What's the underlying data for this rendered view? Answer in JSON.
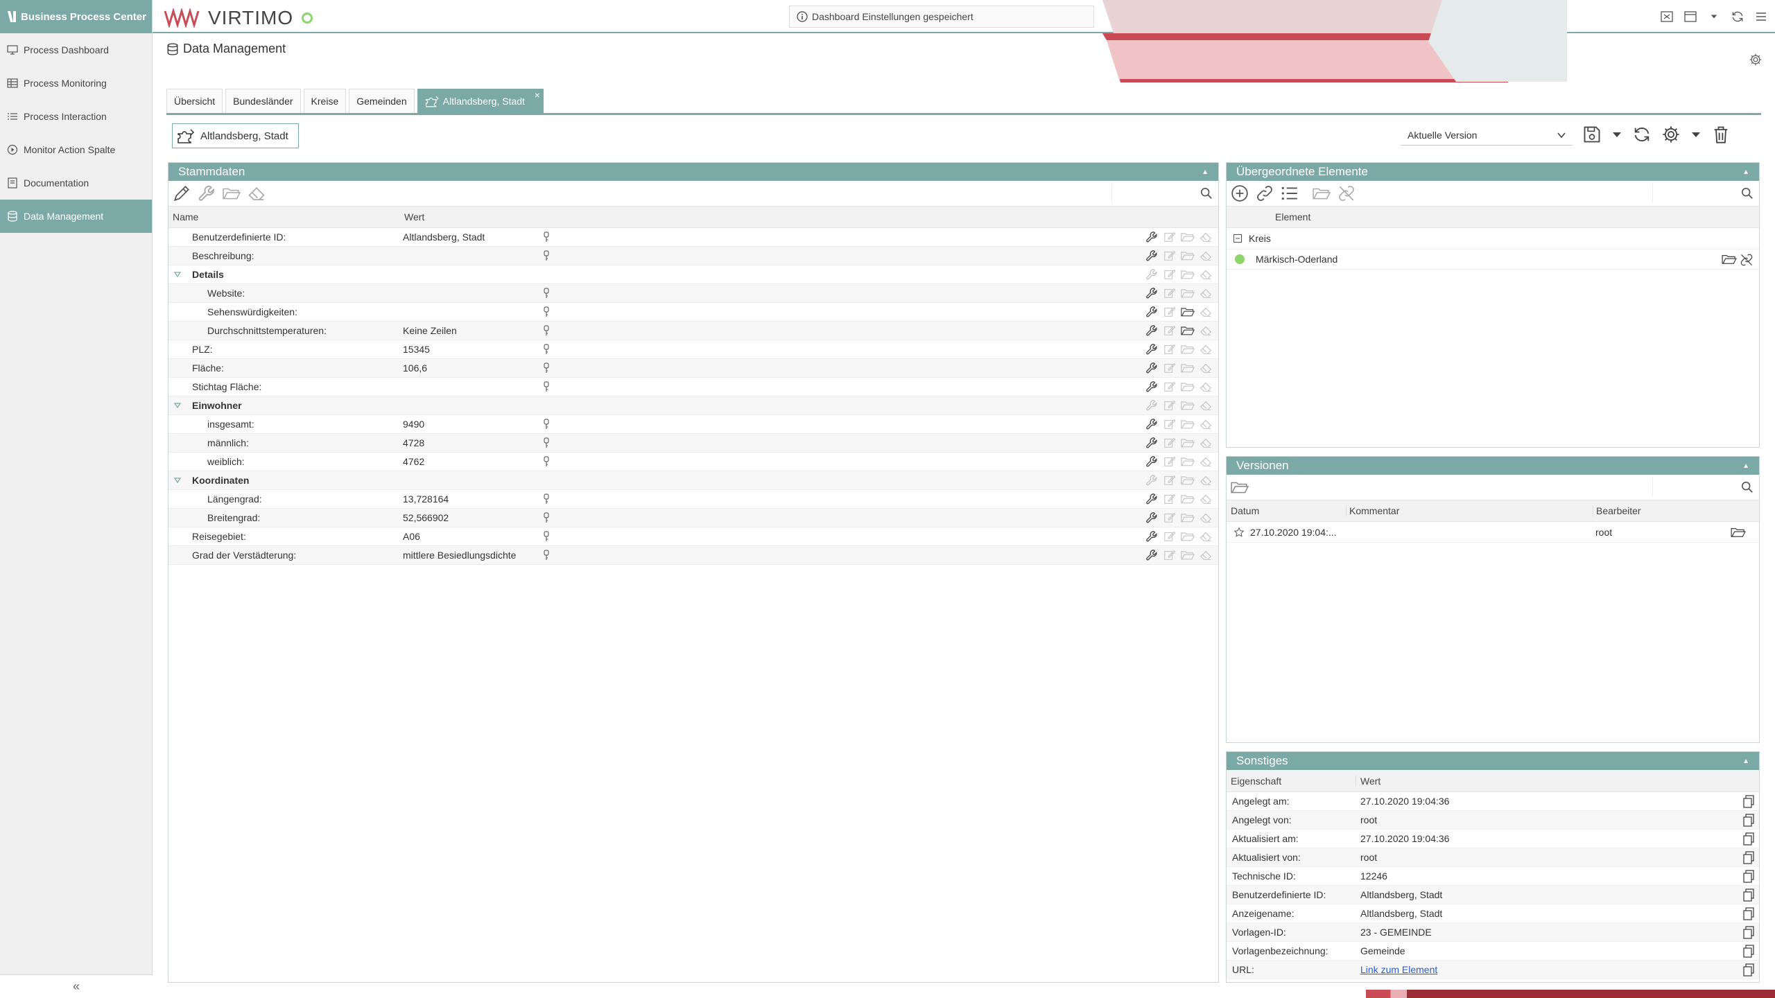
{
  "app": {
    "brand": "Business Process Center",
    "logo_text": "VIRTIMO",
    "notification": "Dashboard Einstellungen gespeichert"
  },
  "sidebar": {
    "items": [
      {
        "label": "Process Dashboard",
        "icon": "monitor-icon"
      },
      {
        "label": "Process Monitoring",
        "icon": "table-icon"
      },
      {
        "label": "Process Interaction",
        "icon": "list-icon"
      },
      {
        "label": "Monitor Action Spalte",
        "icon": "play-circle-icon"
      },
      {
        "label": "Documentation",
        "icon": "book-icon"
      },
      {
        "label": "Data Management",
        "icon": "database-icon",
        "active": true
      }
    ],
    "collapse_label": "«"
  },
  "page": {
    "title": "Data Management"
  },
  "tabs": [
    {
      "label": "Übersicht"
    },
    {
      "label": "Bundesländer"
    },
    {
      "label": "Kreise"
    },
    {
      "label": "Gemeinden"
    },
    {
      "label": "Altlandsberg, Stadt",
      "active": true,
      "close": "×"
    }
  ],
  "entity": {
    "label": "Altlandsberg, Stadt"
  },
  "version_select": {
    "value": "Aktuelle Version"
  },
  "stammdaten": {
    "title": "Stammdaten",
    "col_name": "Name",
    "col_value": "Wert",
    "rows": [
      {
        "name": "Benutzerdefinierte ID:",
        "value": "Altlandsberg, Stadt",
        "level": 1
      },
      {
        "name": "Beschreibung:",
        "value": "",
        "level": 1
      },
      {
        "name": "Details",
        "value": "",
        "group": true
      },
      {
        "name": "Website:",
        "value": "",
        "level": 2
      },
      {
        "name": "Sehenswürdigkeiten:",
        "value": "",
        "level": 2,
        "folder_dark": true
      },
      {
        "name": "Durchschnittstemperaturen:",
        "value": "Keine Zeilen",
        "level": 2,
        "folder_dark": true
      },
      {
        "name": "PLZ:",
        "value": "15345",
        "level": 1
      },
      {
        "name": "Fläche:",
        "value": "106,6",
        "level": 1
      },
      {
        "name": "Stichtag Fläche:",
        "value": "",
        "level": 1
      },
      {
        "name": "Einwohner",
        "value": "",
        "group": true
      },
      {
        "name": "insgesamt:",
        "value": "9490",
        "level": 2
      },
      {
        "name": "männlich:",
        "value": "4728",
        "level": 2
      },
      {
        "name": "weiblich:",
        "value": "4762",
        "level": 2
      },
      {
        "name": "Koordinaten",
        "value": "",
        "group": true
      },
      {
        "name": "Längengrad:",
        "value": "13,728164",
        "level": 2
      },
      {
        "name": "Breitengrad:",
        "value": "52,566902",
        "level": 2
      },
      {
        "name": "Reisegebiet:",
        "value": "A06",
        "level": 1
      },
      {
        "name": "Grad der Verstädterung:",
        "value": "mittlere Besiedlungsdichte",
        "level": 1
      }
    ]
  },
  "uebergeordnete": {
    "title": "Übergeordnete Elemente",
    "col_element": "Element",
    "group": "Kreis",
    "items": [
      {
        "label": "Märkisch-Oderland",
        "status_color": "#8cd66a"
      }
    ]
  },
  "versionen": {
    "title": "Versionen",
    "col_datum": "Datum",
    "col_kommentar": "Kommentar",
    "col_bearbeiter": "Bearbeiter",
    "rows": [
      {
        "datum": "27.10.2020 19:04:...",
        "kommentar": "",
        "bearbeiter": "root"
      }
    ]
  },
  "sonstiges": {
    "title": "Sonstiges",
    "col_eigenschaft": "Eigenschaft",
    "col_wert": "Wert",
    "rows": [
      {
        "key": "Angelegt am:",
        "value": "27.10.2020 19:04:36"
      },
      {
        "key": "Angelegt von:",
        "value": "root"
      },
      {
        "key": "Aktualisiert am:",
        "value": "27.10.2020 19:04:36"
      },
      {
        "key": "Aktualisiert von:",
        "value": "root"
      },
      {
        "key": "Technische ID:",
        "value": "12246"
      },
      {
        "key": "Benutzerdefinierte ID:",
        "value": "Altlandsberg, Stadt"
      },
      {
        "key": "Anzeigename:",
        "value": "Altlandsberg, Stadt"
      },
      {
        "key": "Vorlagen-ID:",
        "value": "23 - GEMEINDE"
      },
      {
        "key": "Vorlagenbezeichnung:",
        "value": "Gemeinde"
      },
      {
        "key": "URL:",
        "value": "Link zum Element",
        "link": true
      }
    ]
  },
  "colors": {
    "accent": "#7aa9a6",
    "status_ok": "#8cd66a",
    "brand_red": "#c94b55"
  }
}
